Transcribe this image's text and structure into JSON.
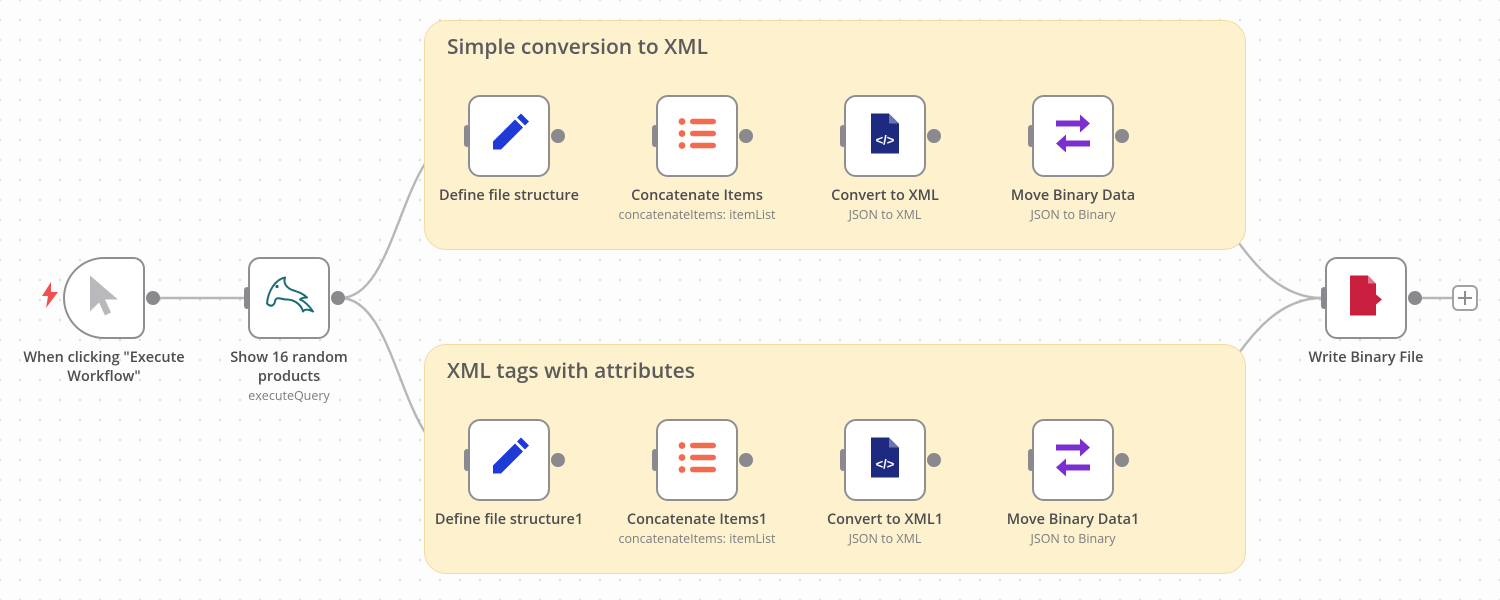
{
  "groups": {
    "top": {
      "title": "Simple conversion to XML"
    },
    "bottom": {
      "title": "XML tags with attributes"
    }
  },
  "nodes": {
    "trigger": {
      "label": "When clicking \"Execute Workflow\""
    },
    "mysql": {
      "label": "Show 16 random products",
      "sub": "executeQuery"
    },
    "def1": {
      "label": "Define file structure"
    },
    "concat1": {
      "label": "Concatenate Items",
      "sub": "concatenateItems: itemList"
    },
    "xml1": {
      "label": "Convert to XML",
      "sub": "JSON to XML"
    },
    "move1": {
      "label": "Move Binary Data",
      "sub": "JSON to Binary"
    },
    "def2": {
      "label": "Define file structure1"
    },
    "concat2": {
      "label": "Concatenate Items1",
      "sub": "concatenateItems: itemList"
    },
    "xml2": {
      "label": "Convert to XML1",
      "sub": "JSON to XML"
    },
    "move2": {
      "label": "Move Binary Data1",
      "sub": "JSON to Binary"
    },
    "write": {
      "label": "Write Binary File"
    }
  },
  "colors": {
    "wire": "#b7b7bb",
    "pencil": "#1e3bd8",
    "list": "#f46a4e",
    "doc": "#1d2a7f",
    "swap": "#7b2fd0",
    "file": "#c81f3e",
    "bolt": "#f44f4f",
    "mysql": "#1a6c73"
  }
}
